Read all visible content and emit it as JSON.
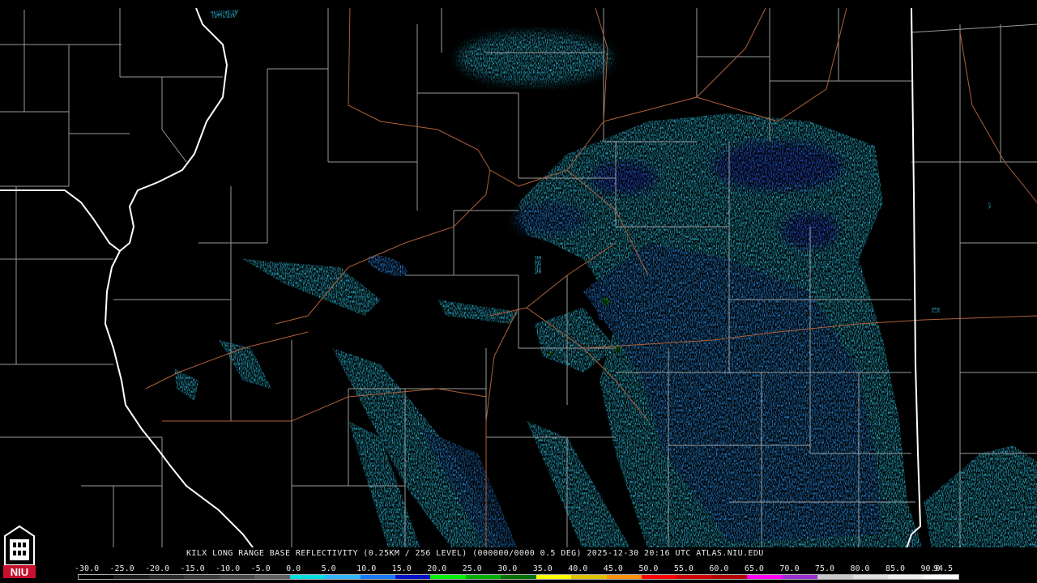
{
  "caption": "KILX LONG RANGE BASE REFLECTIVITY (0.25KM / 256 LEVEL) (000000/0000 0.5 DEG) 2025-12-30 20:16 UTC  ATLAS.NIU.EDU",
  "logo_text": "NIU",
  "scale": {
    "labels": [
      "-30.0",
      "-25.0",
      "-20.0",
      "-15.0",
      "-10.0",
      "-5.0",
      "0.0",
      "5.0",
      "10.0",
      "15.0",
      "20.0",
      "25.0",
      "30.0",
      "35.0",
      "40.0",
      "45.0",
      "50.0",
      "55.0",
      "60.0",
      "65.0",
      "70.0",
      "75.0",
      "80.0",
      "85.0",
      "90.0",
      "94.5"
    ],
    "colors": [
      "#000000",
      "#1a1a1a",
      "#2b2b2b",
      "#3a3a3a",
      "#4a4a4a",
      "#606060",
      "#00e0e0",
      "#30b8ff",
      "#1a78ff",
      "#0010c8",
      "#00f000",
      "#00b000",
      "#007000",
      "#ffff00",
      "#e0c000",
      "#ff9000",
      "#ff0000",
      "#d00000",
      "#b00000",
      "#ff00ff",
      "#9930d0",
      "#c8c8c8",
      "#e0e0e0",
      "#f0f0f0",
      "#ffffff"
    ]
  },
  "colors": {
    "county_lines": "#9a9a9a",
    "state_lines": "#ffffff",
    "roads": "#b0603a",
    "echo_light": "#2ec8e8",
    "echo_mid": "#2a8cf0",
    "echo_strong": "#1a4ed8"
  }
}
